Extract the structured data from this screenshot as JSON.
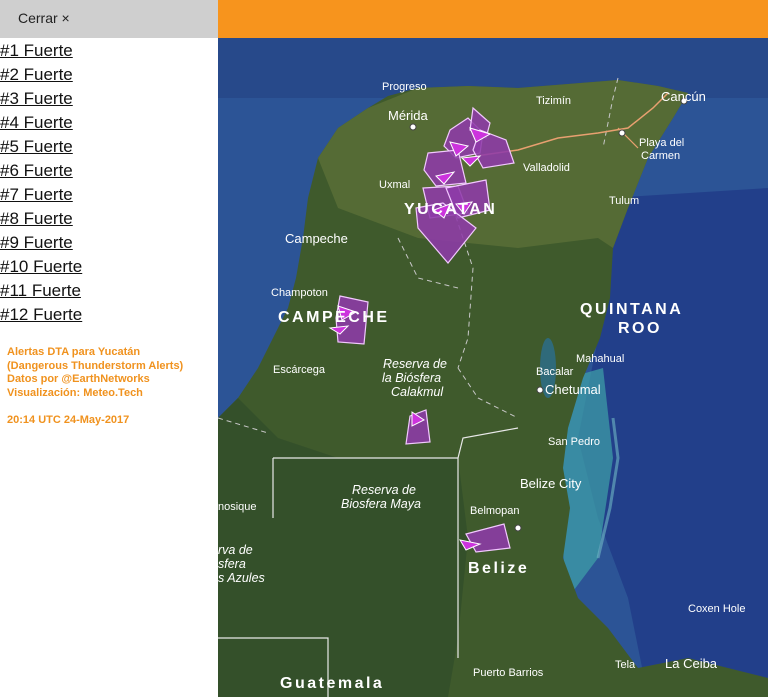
{
  "sidebar": {
    "close_label": "Cerrar ×",
    "alerts": [
      "#1 Fuerte",
      "#2 Fuerte",
      "#3 Fuerte",
      "#4 Fuerte",
      "#5 Fuerte",
      "#6 Fuerte",
      "#7 Fuerte",
      "#8 Fuerte",
      "#9 Fuerte",
      "#10 Fuerte",
      "#11 Fuerte",
      "#12 Fuerte"
    ],
    "credits": {
      "line1": "Alertas DTA para Yucatán",
      "line2": "(Dangerous Thunderstorm Alerts)",
      "line3": "Datos por @EarthNetworks",
      "line4": "Visualización: Meteo.Tech",
      "timestamp": "20:14 UTC 24-May-2017"
    }
  },
  "colors": {
    "accent": "#f7941d",
    "alert_fill": "#8e3aa8",
    "credit_text": "#f0921e"
  },
  "map": {
    "cities": {
      "progreso": "Progreso",
      "merida": "Mérida",
      "tizimin": "Tizimín",
      "cancun": "Cancún",
      "playa": "Playa del",
      "playa2": "Carmen",
      "valladolid": "Valladolid",
      "uxmal": "Uxmal",
      "tulum": "Tulum",
      "campeche": "Campeche",
      "champoton": "Champoton",
      "escarcega": "Escárcega",
      "bacalar": "Bacalar",
      "mahahual": "Mahahual",
      "chetumal": "Chetumal",
      "sanpedro": "San Pedro",
      "belizecity": "Belize City",
      "belmopan": "Belmopan",
      "coxen": "Coxen Hole",
      "tela": "Tela",
      "laceiba": "La Ceiba",
      "puertobarrios": "Puerto Barrios",
      "nosique": "nosique"
    },
    "regions": {
      "yucatan": "YUCATAN",
      "campeche": "CAMPECHE",
      "quintana1": "QUINTANA",
      "quintana2": "ROO",
      "belize": "Belize",
      "guatemala": "Guatemala"
    },
    "reserves": {
      "calakmul1": "Reserva de",
      "calakmul2": "la Biósfera",
      "calakmul3": "Calakmul",
      "maya1": "Reserva de",
      "maya2": "Biosfera Maya",
      "azules1": "rva de",
      "azules2": "sfera",
      "azules3": "s Azules"
    }
  }
}
